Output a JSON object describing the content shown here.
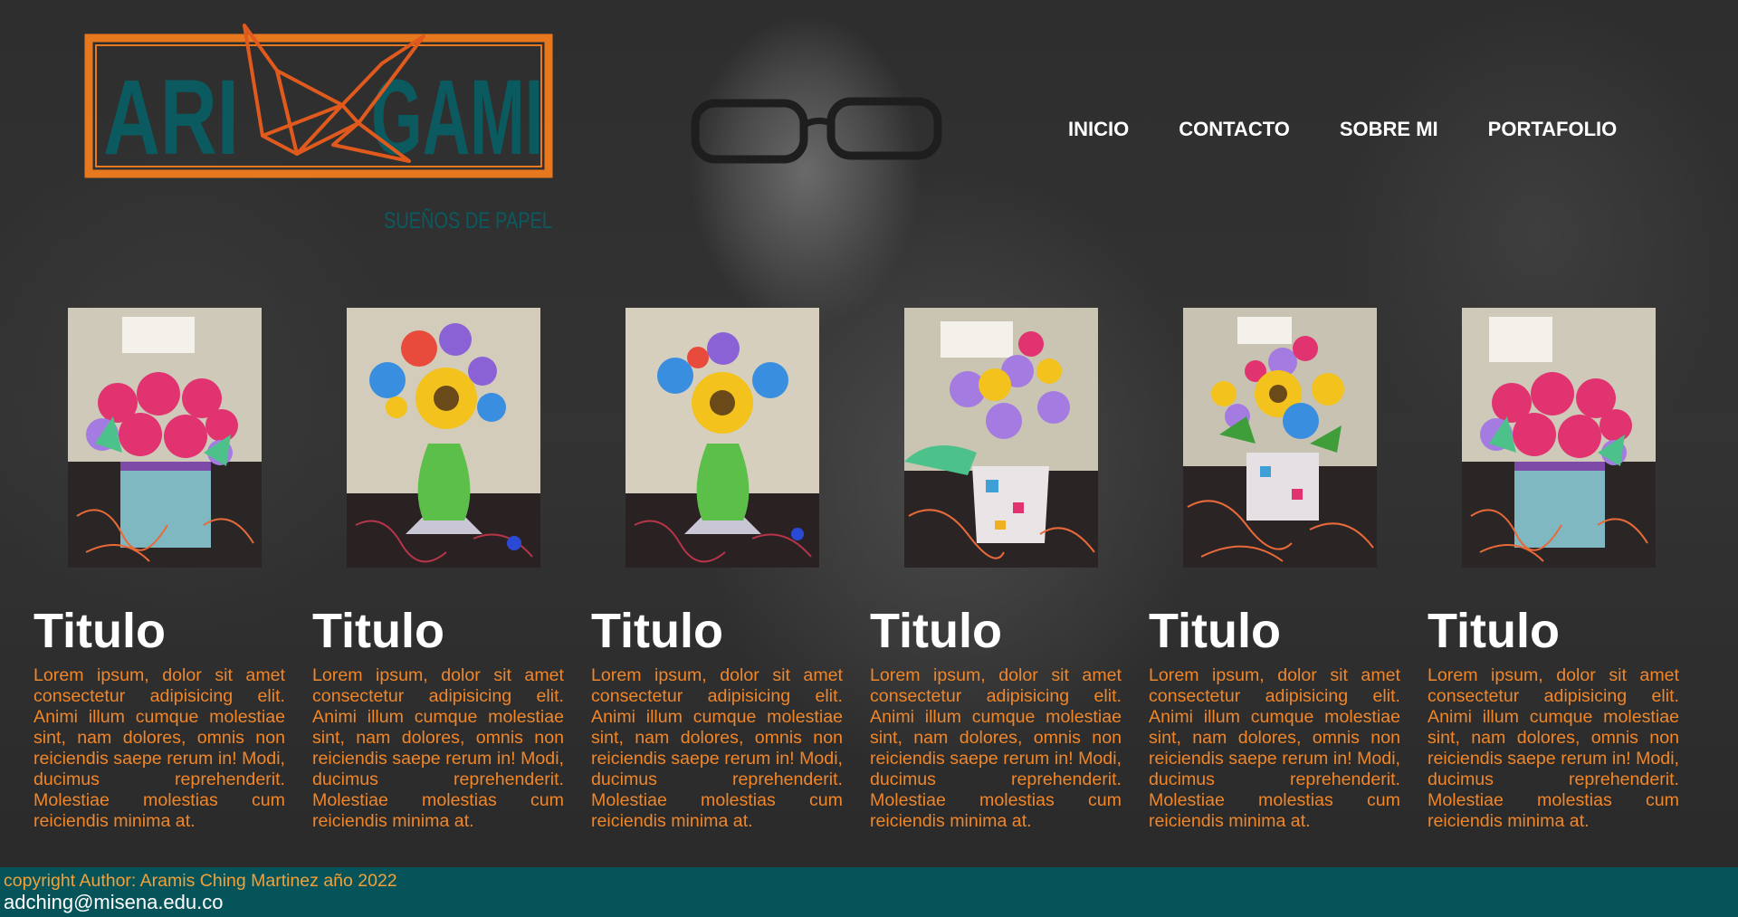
{
  "logo": {
    "word_left": "ARI",
    "word_right": "GAMI",
    "tagline": "SUEÑOS DE PAPEL",
    "colors": {
      "frame": "#e8781e",
      "text": "#0b5a60",
      "crane": "#e05a1e"
    }
  },
  "nav": {
    "items": [
      "INICIO",
      "CONTACTO",
      "SOBRE MI",
      "PORTAFOLIO"
    ]
  },
  "cards": [
    {
      "title": "Titulo",
      "text": "Lorem ipsum, dolor sit amet consectetur adipisicing elit. Animi illum cumque molestiae sint, nam dolores, omnis non reiciendis saepe rerum in! Modi, ducimus reprehenderit. Molestiae molestias cum reiciendis minima at.",
      "image": "pink-roses-bouquet"
    },
    {
      "title": "Titulo",
      "text": "Lorem ipsum, dolor sit amet consectetur adipisicing elit. Animi illum cumque molestiae sint, nam dolores, omnis non reiciendis saepe rerum in! Modi, ducimus reprehenderit. Molestiae molestias cum reiciendis minima at.",
      "image": "sunflower-vase"
    },
    {
      "title": "Titulo",
      "text": "Lorem ipsum, dolor sit amet consectetur adipisicing elit. Animi illum cumque molestiae sint, nam dolores, omnis non reiciendis saepe rerum in! Modi, ducimus reprehenderit. Molestiae molestias cum reiciendis minima at.",
      "image": "sunflower-vase"
    },
    {
      "title": "Titulo",
      "text": "Lorem ipsum, dolor sit amet consectetur adipisicing elit. Animi illum cumque molestiae sint, nam dolores, omnis non reiciendis saepe rerum in! Modi, ducimus reprehenderit. Molestiae molestias cum reiciendis minima at.",
      "image": "mixed-flower-box"
    },
    {
      "title": "Titulo",
      "text": "Lorem ipsum, dolor sit amet consectetur adipisicing elit. Animi illum cumque molestiae sint, nam dolores, omnis non reiciendis saepe rerum in! Modi, ducimus reprehenderit. Molestiae molestias cum reiciendis minima at.",
      "image": "sunflower-box"
    },
    {
      "title": "Titulo",
      "text": "Lorem ipsum, dolor sit amet consectetur adipisicing elit. Animi illum cumque molestiae sint, nam dolores, omnis non reiciendis saepe rerum in! Modi, ducimus reprehenderit. Molestiae molestias cum reiciendis minima at.",
      "image": "pink-roses-bouquet"
    }
  ],
  "footer": {
    "copyright": "copyright Author: Aramis Ching Martinez año 2022",
    "email": "adching@misena.edu.co",
    "background": "#06545a"
  }
}
